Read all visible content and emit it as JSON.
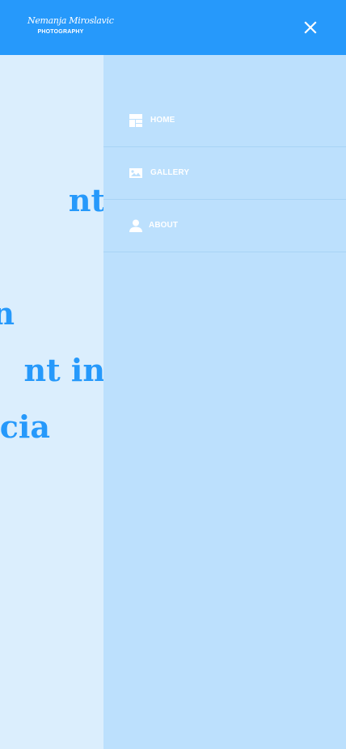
{
  "header": {
    "logo": {
      "script": "Nemanja Miroslavic",
      "subtitle": "PHOTOGRAPHY"
    },
    "close_icon": "close-icon",
    "color": "#2699fb"
  },
  "hero": {
    "lines": [
      "nt",
      "n",
      "nt in",
      "acia"
    ],
    "text_color": "#2699fb"
  },
  "drawer": {
    "background": "#bce0fd",
    "items": [
      {
        "label": "HOME",
        "icon": "home-icon"
      },
      {
        "label": "GALLERY",
        "icon": "gallery-icon"
      },
      {
        "label": "ABOUT",
        "icon": "person-icon"
      }
    ]
  }
}
